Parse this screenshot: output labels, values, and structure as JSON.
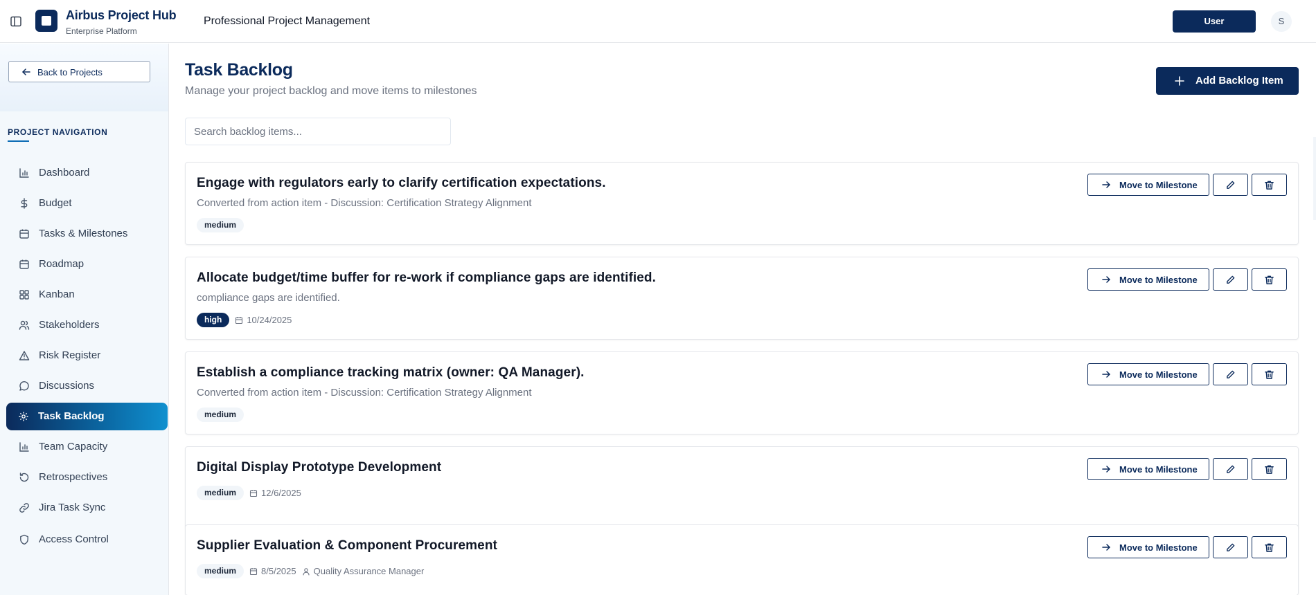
{
  "header": {
    "app_title": "Airbus Project Hub",
    "app_subtitle": "Enterprise Platform",
    "page_context": "Professional Project Management",
    "user_button": "User",
    "avatar_initial": "S"
  },
  "sidebar": {
    "back_label": "Back to Projects",
    "nav_heading": "PROJECT NAVIGATION",
    "items": [
      {
        "label": "Dashboard",
        "icon": "bar-chart-icon"
      },
      {
        "label": "Budget",
        "icon": "dollar-icon"
      },
      {
        "label": "Tasks & Milestones",
        "icon": "calendar-icon"
      },
      {
        "label": "Roadmap",
        "icon": "calendar-icon"
      },
      {
        "label": "Kanban",
        "icon": "grid-icon"
      },
      {
        "label": "Stakeholders",
        "icon": "users-icon"
      },
      {
        "label": "Risk Register",
        "icon": "alert-triangle-icon"
      },
      {
        "label": "Discussions",
        "icon": "message-circle-icon"
      },
      {
        "label": "Task Backlog",
        "icon": "gear-icon",
        "active": true
      },
      {
        "label": "Team Capacity",
        "icon": "bar-chart-icon"
      },
      {
        "label": "Retrospectives",
        "icon": "rotate-icon"
      },
      {
        "label": "Jira Task Sync",
        "icon": "link-icon"
      },
      {
        "label": "Access Control",
        "icon": "shield-icon"
      }
    ]
  },
  "main": {
    "title": "Task Backlog",
    "subtitle": "Manage your project backlog and move items to milestones",
    "add_button": "Add Backlog Item",
    "search_placeholder": "Search backlog items...",
    "move_label": "Move to Milestone",
    "items": [
      {
        "title": "Engage with regulators early to clarify certification expectations.",
        "description": "Converted from action item - Discussion: Certification Strategy Alignment",
        "priority": "medium",
        "date": "",
        "owner": ""
      },
      {
        "title": "Allocate budget/time buffer for re-work if compliance gaps are identified.",
        "description": "compliance gaps are identified.",
        "priority": "high",
        "date": "10/24/2025",
        "owner": ""
      },
      {
        "title": "Establish a compliance tracking matrix (owner: QA Manager).",
        "description": "Converted from action item - Discussion: Certification Strategy Alignment",
        "priority": "medium",
        "date": "",
        "owner": ""
      },
      {
        "title": "Digital Display Prototype Development",
        "description": "",
        "priority": "medium",
        "date": "12/6/2025",
        "owner": ""
      },
      {
        "title": "Supplier Evaluation & Component Procurement",
        "description": "",
        "priority": "medium",
        "date": "8/5/2025",
        "owner": "Quality Assurance Manager"
      }
    ]
  },
  "colors": {
    "brand_navy": "#0b2a5b",
    "accent_blue": "#0b6ca8",
    "sidebar_bg": "#f3f8fc"
  }
}
